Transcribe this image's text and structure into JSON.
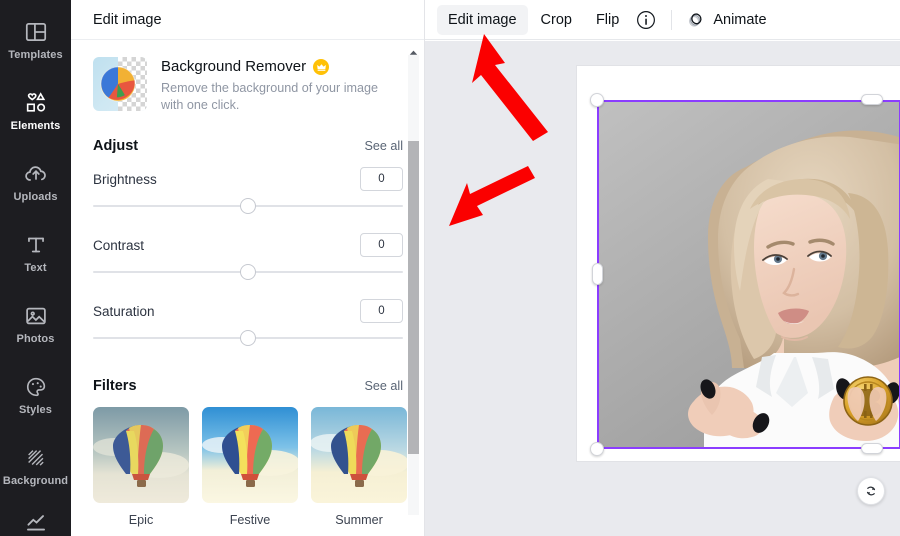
{
  "sidebar": {
    "items": [
      {
        "label": "Templates",
        "icon": "templates-icon",
        "active": false
      },
      {
        "label": "Elements",
        "icon": "elements-icon",
        "active": true
      },
      {
        "label": "Uploads",
        "icon": "uploads-icon",
        "active": false
      },
      {
        "label": "Text",
        "icon": "text-icon",
        "active": false
      },
      {
        "label": "Photos",
        "icon": "photos-icon",
        "active": false
      },
      {
        "label": "Styles",
        "icon": "styles-icon",
        "active": false
      },
      {
        "label": "Background",
        "icon": "background-icon",
        "active": false
      },
      {
        "label": "",
        "icon": "chart-icon",
        "active": false
      }
    ]
  },
  "panel": {
    "title": "Edit image",
    "background_remover": {
      "name": "Background Remover",
      "badge": "pro-crown-icon",
      "description": "Remove the background of your image with one click."
    },
    "adjust": {
      "title": "Adjust",
      "see_all": "See all",
      "sliders": [
        {
          "label": "Brightness",
          "value": "0"
        },
        {
          "label": "Contrast",
          "value": "0"
        },
        {
          "label": "Saturation",
          "value": "0"
        }
      ]
    },
    "filters": {
      "title": "Filters",
      "see_all": "See all",
      "items": [
        {
          "label": "Epic"
        },
        {
          "label": "Festive"
        },
        {
          "label": "Summer"
        }
      ]
    }
  },
  "toolbar": {
    "edit_image": "Edit image",
    "crop": "Crop",
    "flip": "Flip",
    "info_icon": "info-icon",
    "animate": "Animate",
    "animate_icon": "animate-icon"
  },
  "canvas": {
    "rotate_icon": "rotate-icon",
    "selection_color": "#8b3dff"
  },
  "annotations": {
    "arrow_color": "#fb0000",
    "arrows": [
      {
        "name": "arrow-to-edit-image",
        "points_to": "Edit image"
      },
      {
        "name": "arrow-to-panel",
        "points_to": "Edit image panel"
      }
    ]
  }
}
